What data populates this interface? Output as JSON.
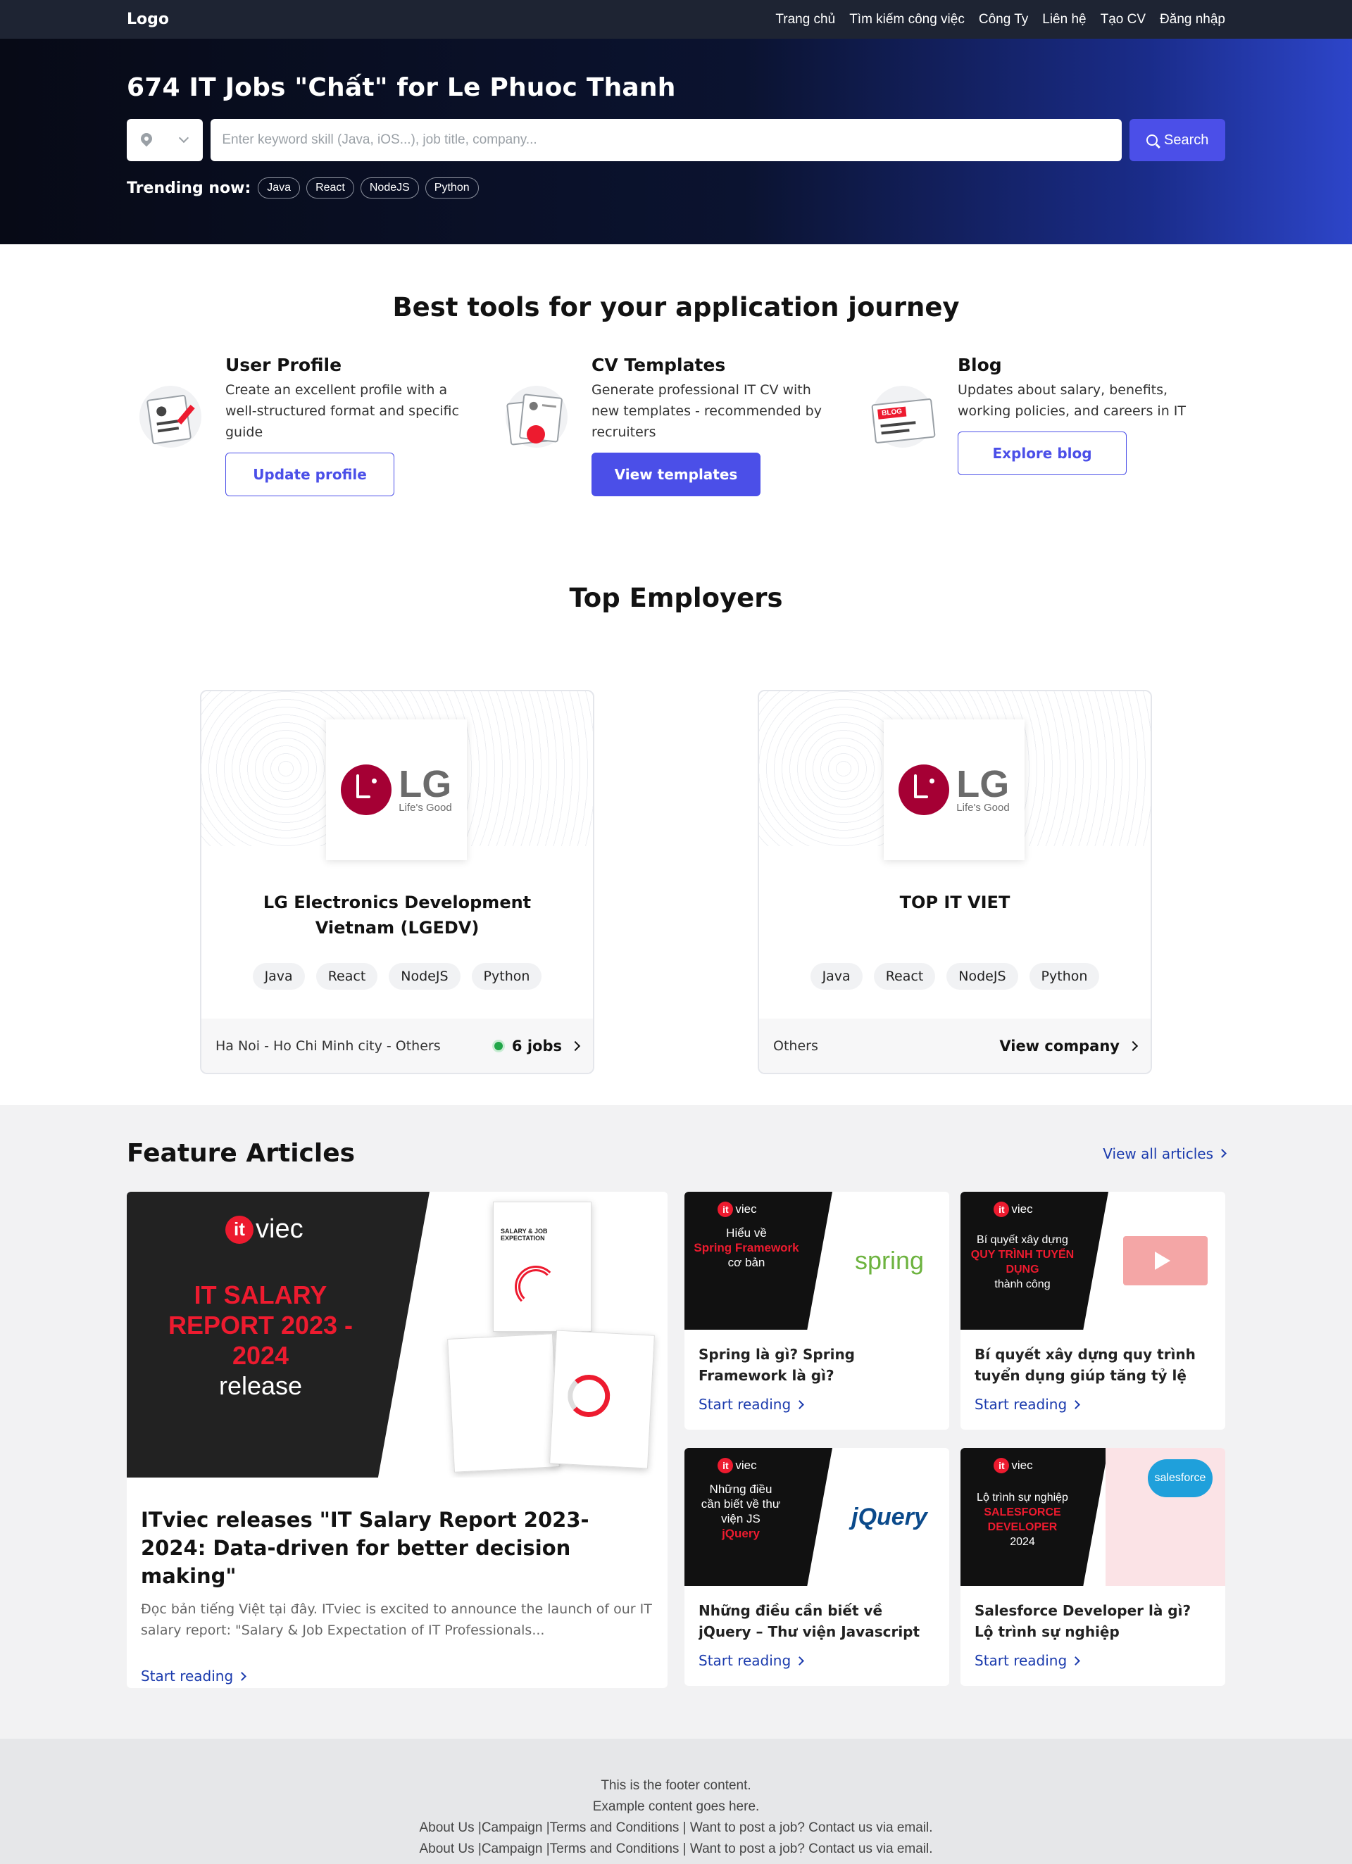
{
  "nav": {
    "logo": "Logo",
    "links": [
      "Trang chủ",
      "Tìm kiếm công việc",
      "Công Ty",
      "Liên hệ",
      "Tạo CV",
      "Đăng nhập"
    ]
  },
  "hero": {
    "title": "674 IT Jobs \"Chất\" for Le Phuoc Thanh",
    "search_placeholder": "Enter keyword skill (Java, iOS...), job title, company...",
    "search_button": "Search",
    "trending_label": "Trending now:",
    "trending": [
      "Java",
      "React",
      "NodeJS",
      "Python"
    ]
  },
  "tools": {
    "title": "Best tools for your application journey",
    "items": [
      {
        "title": "User Profile",
        "desc": "Create an excellent profile with a well-structured format and specific guide",
        "button": "Update profile",
        "icon": "profile-document-icon"
      },
      {
        "title": "CV Templates",
        "desc": "Generate professional IT CV with new templates - recommended by recruiters",
        "button": "View templates",
        "icon": "cv-download-icon"
      },
      {
        "title": "Blog",
        "desc": "Updates about salary, benefits, working policies, and careers in IT",
        "button": "Explore blog",
        "icon": "blog-icon"
      }
    ]
  },
  "employers": {
    "title": "Top Employers",
    "cards": [
      {
        "logo_text": "LG",
        "logo_tagline": "Life's Good",
        "name": "LG Electronics Development Vietnam (LGEDV)",
        "tags": [
          "Java",
          "React",
          "NodeJS",
          "Python"
        ],
        "location": "Ha Noi - Ho Chi Minh city - Others",
        "action": "6 jobs"
      },
      {
        "logo_text": "LG",
        "logo_tagline": "Life's Good",
        "name": "TOP IT VIET",
        "tags": [
          "Java",
          "React",
          "NodeJS",
          "Python"
        ],
        "location": "Others",
        "action": "View company"
      }
    ]
  },
  "articles": {
    "title": "Feature Articles",
    "view_all": "View all articles",
    "featured": {
      "brand_it": "it",
      "brand_viec": "viec",
      "image_headline": "IT SALARY REPORT 2023 - 2024",
      "image_sub": "release",
      "book_title": "SALARY & JOB EXPECTATION",
      "title": "ITviec releases \"IT Salary Report 2023-2024: Data-driven for better decision making\"",
      "excerpt": "Đọc bản tiếng Việt tại đây. ITviec is excited to announce the launch of our IT salary report: \"Salary & Job Expectation of IT Professionals...",
      "read": "Start reading"
    },
    "items": [
      {
        "img_lines": [
          "Hiểu về"
        ],
        "img_highlight": "Spring Framework",
        "img_after": "cơ bản",
        "logo": "spring",
        "title": "Spring là gì? Spring Framework là gì?",
        "read": "Start reading"
      },
      {
        "img_lines": [
          "Bí quyết xây dựng"
        ],
        "img_highlight": "QUY TRÌNH TUYỂN DỤNG",
        "img_after": "thành công",
        "logo": "",
        "title": "Bí quyết xây dựng quy trình tuyển dụng giúp tăng tỷ lệ thàn...",
        "read": "Start reading"
      },
      {
        "img_lines": [
          "Những điều cần biết về thư viện JS"
        ],
        "img_highlight": "jQuery",
        "img_after": "",
        "logo": "jQuery",
        "title": "Những điều cần biết về jQuery – Thư viện Javascript hàng đầu...",
        "read": "Start reading"
      },
      {
        "img_lines": [
          "Lộ trình sự nghiệp"
        ],
        "img_highlight": "SALESFORCE DEVELOPER",
        "img_after": "2024",
        "logo": "salesforce",
        "title": "Salesforce Developer là gì? Lộ trình sự nghiệp Salesforce...",
        "read": "Start reading"
      }
    ]
  },
  "footer": {
    "lines": [
      "This is the footer content.",
      "Example content goes here.",
      "About Us |Campaign |Terms and Conditions | Want to post a job? Contact us via email.",
      "About Us |Campaign |Terms and Conditions | Want to post a job? Contact us via email."
    ]
  },
  "colors": {
    "primary": "#4b4fe8",
    "nav_bg": "#1e2433",
    "link": "#1a3aad",
    "brand_red": "#ed1b2f"
  }
}
